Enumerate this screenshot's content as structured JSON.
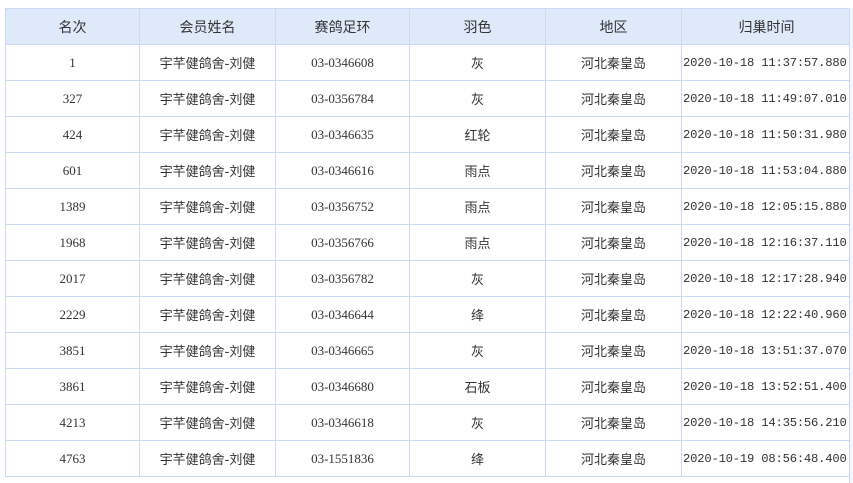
{
  "table": {
    "headers": {
      "rank": "名次",
      "member_name": "会员姓名",
      "ring_number": "赛鸽足环",
      "feather_color": "羽色",
      "region": "地区",
      "return_time": "归巢时间"
    },
    "rows": [
      {
        "rank": "1",
        "member_name": "宇芊健鸽舍-刘健",
        "ring_number": "03-0346608",
        "feather_color": "灰",
        "region": "河北秦皇岛",
        "return_time": "2020-10-18 11:37:57.880"
      },
      {
        "rank": "327",
        "member_name": "宇芊健鸽舍-刘健",
        "ring_number": "03-0356784",
        "feather_color": "灰",
        "region": "河北秦皇岛",
        "return_time": "2020-10-18 11:49:07.010"
      },
      {
        "rank": "424",
        "member_name": "宇芊健鸽舍-刘健",
        "ring_number": "03-0346635",
        "feather_color": "红轮",
        "region": "河北秦皇岛",
        "return_time": "2020-10-18 11:50:31.980"
      },
      {
        "rank": "601",
        "member_name": "宇芊健鸽舍-刘健",
        "ring_number": "03-0346616",
        "feather_color": "雨点",
        "region": "河北秦皇岛",
        "return_time": "2020-10-18 11:53:04.880"
      },
      {
        "rank": "1389",
        "member_name": "宇芊健鸽舍-刘健",
        "ring_number": "03-0356752",
        "feather_color": "雨点",
        "region": "河北秦皇岛",
        "return_time": "2020-10-18 12:05:15.880"
      },
      {
        "rank": "1968",
        "member_name": "宇芊健鸽舍-刘健",
        "ring_number": "03-0356766",
        "feather_color": "雨点",
        "region": "河北秦皇岛",
        "return_time": "2020-10-18 12:16:37.110"
      },
      {
        "rank": "2017",
        "member_name": "宇芊健鸽舍-刘健",
        "ring_number": "03-0356782",
        "feather_color": "灰",
        "region": "河北秦皇岛",
        "return_time": "2020-10-18 12:17:28.940"
      },
      {
        "rank": "2229",
        "member_name": "宇芊健鸽舍-刘健",
        "ring_number": "03-0346644",
        "feather_color": "绛",
        "region": "河北秦皇岛",
        "return_time": "2020-10-18 12:22:40.960"
      },
      {
        "rank": "3851",
        "member_name": "宇芊健鸽舍-刘健",
        "ring_number": "03-0346665",
        "feather_color": "灰",
        "region": "河北秦皇岛",
        "return_time": "2020-10-18 13:51:37.070"
      },
      {
        "rank": "3861",
        "member_name": "宇芊健鸽舍-刘健",
        "ring_number": "03-0346680",
        "feather_color": "石板",
        "region": "河北秦皇岛",
        "return_time": "2020-10-18 13:52:51.400"
      },
      {
        "rank": "4213",
        "member_name": "宇芊健鸽舍-刘健",
        "ring_number": "03-0346618",
        "feather_color": "灰",
        "region": "河北秦皇岛",
        "return_time": "2020-10-18 14:35:56.210"
      },
      {
        "rank": "4763",
        "member_name": "宇芊健鸽舍-刘健",
        "ring_number": "03-1551836",
        "feather_color": "绛",
        "region": "河北秦皇岛",
        "return_time": "2020-10-19 08:56:48.400"
      }
    ]
  },
  "colors": {
    "header_background": "#deeafa",
    "grid_border": "#c9daf2",
    "text": "#333333"
  }
}
